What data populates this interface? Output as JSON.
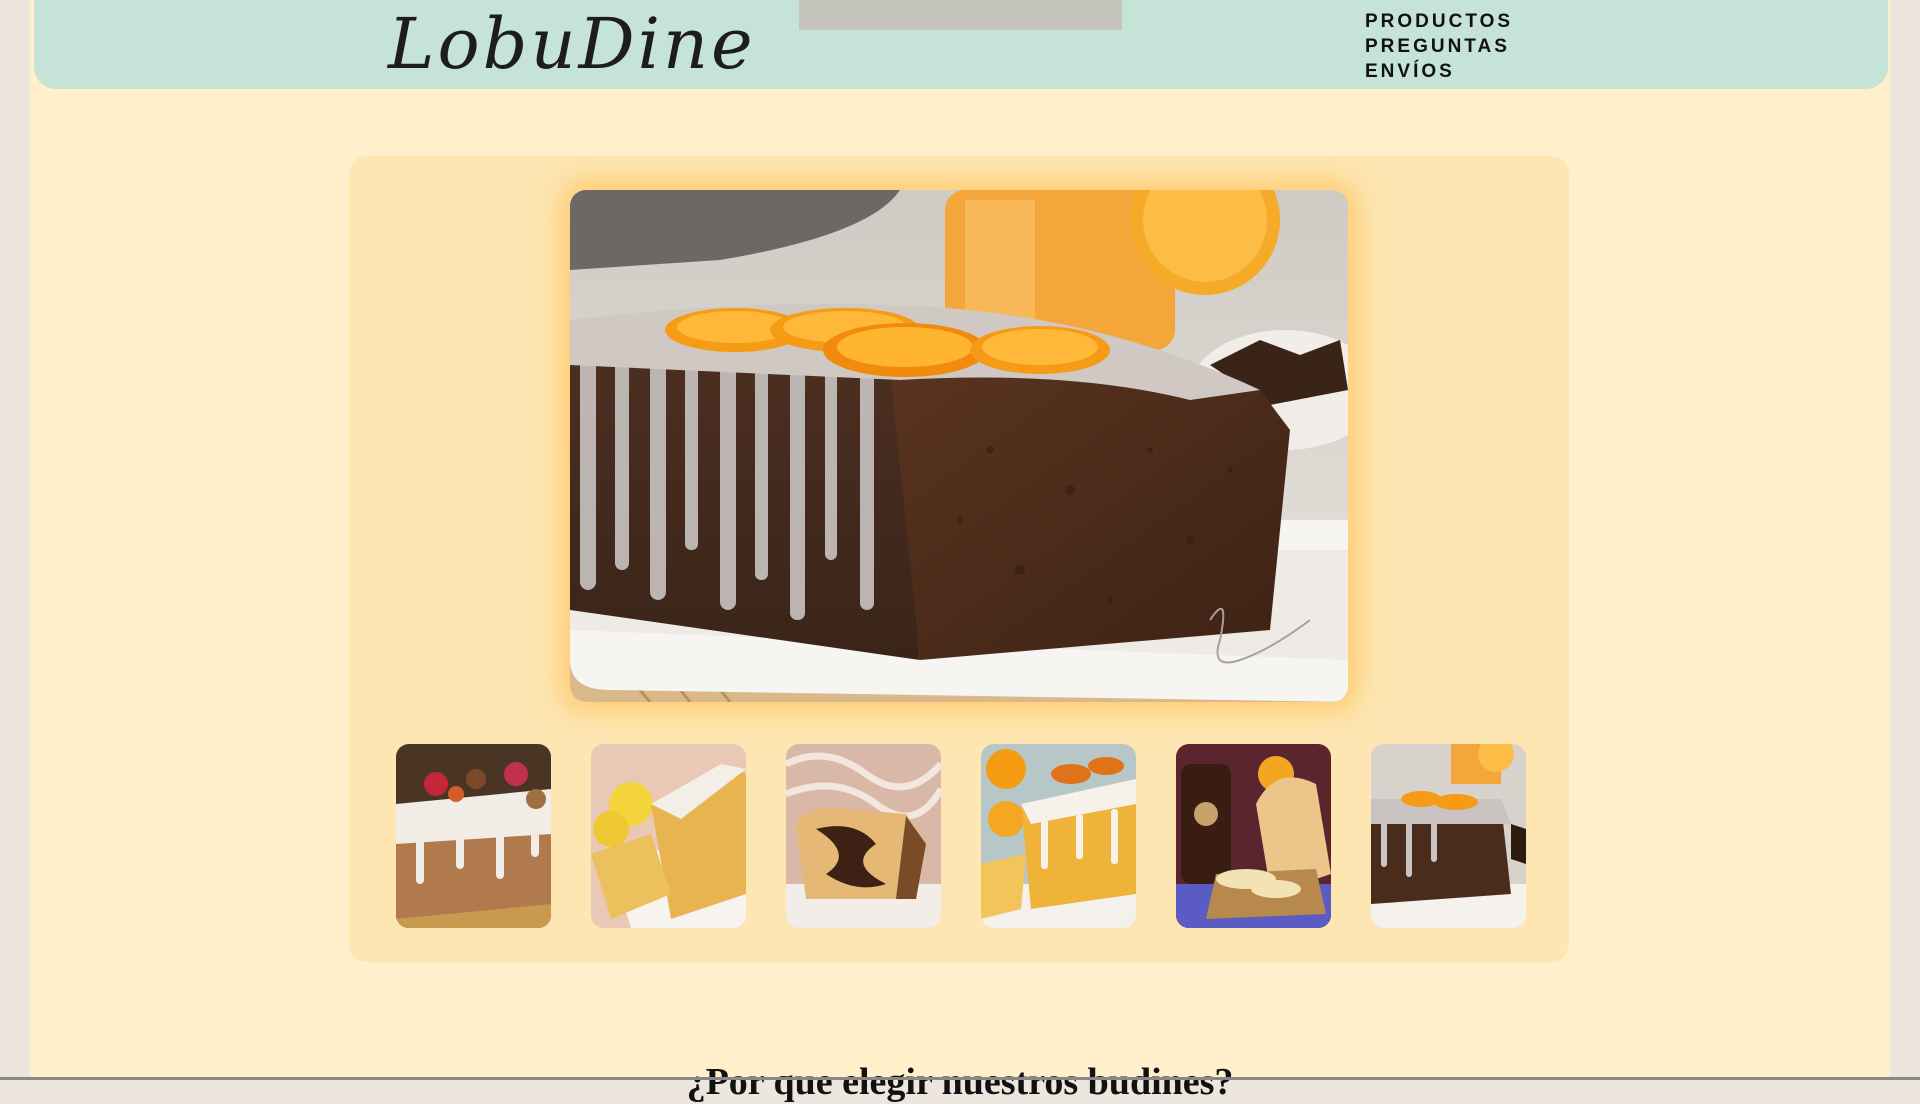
{
  "header": {
    "logo_text": "LobuDine",
    "nav_items": [
      {
        "label": "PRODUCTOS"
      },
      {
        "label": "PREGUNTAS"
      },
      {
        "label": "ENVÍOS"
      }
    ]
  },
  "gallery": {
    "main_image": {
      "icon": "budin-glaseado-naranja-image"
    },
    "thumbnails": [
      {
        "icon": "budin-frutas-image"
      },
      {
        "icon": "budin-limon-image"
      },
      {
        "icon": "budin-marmolado-image"
      },
      {
        "icon": "budin-naranja-image"
      },
      {
        "icon": "budin-vainilla-image"
      },
      {
        "icon": "budin-chocolate-naranja-image"
      }
    ]
  },
  "section": {
    "title": "¿Por que elegir nuestros budines?"
  },
  "colors": {
    "header_bg": "#c5e3d6",
    "page_bg": "#fff0cb",
    "gallery_bg": "#fde6b2",
    "glow": "#ffbe50"
  }
}
